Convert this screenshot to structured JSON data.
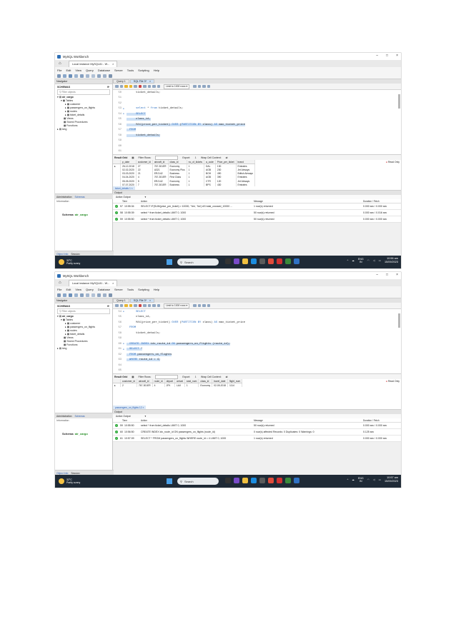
{
  "window": {
    "title": "MySQL Workbench",
    "connection_tab": "Local instance MySQL81 - W...",
    "controls": {
      "minimize": "–",
      "maximize": "□",
      "close": "×"
    }
  },
  "menu": [
    "File",
    "Edit",
    "View",
    "Query",
    "Database",
    "Server",
    "Tools",
    "Scripting",
    "Help"
  ],
  "navigator": {
    "header": "Navigator",
    "schemas_label": "SCHEMAS",
    "filter_placeholder": "Filter objects",
    "tree": {
      "schema": "air_cargo",
      "tables": "Tables",
      "table_items": [
        "customer",
        "passengers_on_flights",
        "routes",
        "ticket_details"
      ],
      "views": "Views",
      "procedures": "Stored Procedures",
      "functions": "Functions",
      "other_schema": "king"
    },
    "tabs": {
      "administration": "Administration",
      "schemas": "Schemas"
    },
    "information": "Information",
    "schema_label": "Schema:",
    "schema_value": "air_cargo",
    "bottom_tabs": {
      "object_info": "Object Info",
      "session": "Session"
    }
  },
  "editor": {
    "query_tab": "Query 1",
    "file_tab": "SQL File 3*",
    "limit_label": "Limit to 1000 rows"
  },
  "result": {
    "result_grid": "Result Grid",
    "filter_rows": "Filter Rows:",
    "export": "Export:",
    "wrap": "Wrap Cell Content:",
    "read_only": "Read Only"
  },
  "output": {
    "header": "Output",
    "action_output": "Action Output",
    "columns": {
      "time": "Time",
      "action": "Action",
      "message": "Message",
      "duration": "Duration / Fetch"
    }
  },
  "taskbar": {
    "temp": "32°C",
    "weather": "Partly sunny",
    "search": "Search",
    "lang1": "ENG",
    "lang2": "IN"
  },
  "screens": [
    {
      "sql_lines": [
        {
          "n": "50",
          "text": "    ticket_details;",
          "hl": false,
          "mark": ""
        },
        {
          "n": "51",
          "text": "",
          "hl": false,
          "mark": ""
        },
        {
          "n": "52",
          "text": "",
          "hl": false,
          "mark": ""
        },
        {
          "n": "53",
          "text": "    select * from ticket_details;",
          "hl": false,
          "mark": "●"
        },
        {
          "n": "54",
          "text": "    SELECT",
          "hl": true,
          "mark": "●"
        },
        {
          "n": "55",
          "text": "    class_id,",
          "hl": true,
          "mark": ""
        },
        {
          "n": "56",
          "text": "    MAX(price_per_ticket) OVER (PARTITION BY class) AS max_ticket_price",
          "hl": true,
          "mark": ""
        },
        {
          "n": "57",
          "text": "FROM",
          "hl": true,
          "mark": ""
        },
        {
          "n": "58",
          "text": "    ticket_details;",
          "hl": true,
          "mark": ""
        },
        {
          "n": "59",
          "text": "",
          "hl": false,
          "mark": ""
        },
        {
          "n": "60",
          "text": "",
          "hl": false,
          "mark": ""
        },
        {
          "n": "61",
          "text": "",
          "hl": false,
          "mark": ""
        }
      ],
      "grid": {
        "columns": [
          "p_date",
          "customer_id",
          "aircraft_id",
          "class_id",
          "no_of_tickets",
          "a_code",
          "Price_per_ticket",
          "brand"
        ],
        "rows": [
          [
            "26-12-2018",
            "27",
            "767-301ER",
            "Economy",
            "1",
            "DAL",
            "130",
            "Emirates"
          ],
          [
            "02-02-2020",
            "22",
            "A321",
            "Economy Plus",
            "1",
            "AGB",
            "230",
            "Jet Airways"
          ],
          [
            "03-03-2020",
            "21",
            "ERJ142",
            "Business",
            "1",
            "BOH",
            "490",
            "British Airways"
          ],
          [
            "04-04-2020",
            "4",
            "767-301ER",
            "First Class",
            "1",
            "AGB",
            "390",
            "Emirates"
          ],
          [
            "05-05-2020",
            "5",
            "ERJ142",
            "Economy",
            "1",
            "CTR",
            "120",
            "Jet Airways"
          ],
          [
            "07-07-2020",
            "7",
            "767-301ER",
            "Business",
            "1",
            "BPS",
            "430",
            "Emirates"
          ]
        ],
        "bottom_tab": "ticket_details 1 ×"
      },
      "output_rows": [
        {
          "num": "57",
          "time": "10:55:34",
          "action": "SELECT    IF(SUM(price_per_ticket) > 10000, 'Yes', 'No') AS total_crossed_10000 ...",
          "message": "1 row(s) returned",
          "duration": "0.000 sec / 0.000 sec"
        },
        {
          "num": "58",
          "time": "10:55:39",
          "action": "select * from ticket_details LIMIT 0, 1000",
          "message": "50 row(s) returned",
          "duration": "0.000 sec / 0.016 sec"
        },
        {
          "num": "59",
          "time": "10:55:50",
          "action": "select * from ticket_details LIMIT 0, 1000",
          "message": "50 row(s) returned",
          "duration": "0.000 sec / 0.000 sec"
        }
      ],
      "clock": {
        "time": "10:56 am",
        "date": "15/09/2023"
      }
    },
    {
      "sql_lines": [
        {
          "n": "54",
          "text": "    SELECT",
          "hl": false,
          "mark": "●"
        },
        {
          "n": "55",
          "text": "    class_id,",
          "hl": false,
          "mark": ""
        },
        {
          "n": "56",
          "text": "    MAX(price_per_ticket) OVER (PARTITION BY class) AS max_ticket_price",
          "hl": false,
          "mark": ""
        },
        {
          "n": "57",
          "text": "FROM",
          "hl": false,
          "mark": ""
        },
        {
          "n": "58",
          "text": "    ticket_details;",
          "hl": false,
          "mark": ""
        },
        {
          "n": "59",
          "text": "",
          "hl": false,
          "mark": ""
        },
        {
          "n": "60",
          "text": "CREATE INDEX idx_route_id ON passengers_on_flights (route_id);",
          "hl": true,
          "mark": "●"
        },
        {
          "n": "61",
          "text": "SELECT *",
          "hl": true,
          "mark": "●"
        },
        {
          "n": "62",
          "text": "FROM passengers_on_flights",
          "hl": true,
          "mark": ""
        },
        {
          "n": "63",
          "text": "WHERE route_id = 4;",
          "hl": true,
          "mark": ""
        },
        {
          "n": "64",
          "text": "",
          "hl": false,
          "mark": ""
        },
        {
          "n": "65",
          "text": "",
          "hl": false,
          "mark": ""
        }
      ],
      "grid": {
        "columns": [
          "customer_id",
          "aircraft_id",
          "route_id",
          "depart",
          "arrival",
          "seat_num",
          "class_id",
          "travel_date",
          "flight_num"
        ],
        "rows": [
          [
            "2",
            "767-301ER",
            "4",
            "JFK",
            "LAX",
            "1",
            "Economy",
            "02-05-2018",
            "1114"
          ]
        ],
        "bottom_tab": "passengers_on_flights 12 ×"
      },
      "output_rows": [
        {
          "num": "59",
          "time": "10:55:50",
          "action": "select * from ticket_details LIMIT 0, 1000",
          "message": "50 row(s) returned",
          "duration": "0.000 sec / 0.000 sec"
        },
        {
          "num": "60",
          "time": "10:56:50",
          "action": "CREATE INDEX idx_route_id ON passengers_on_flights (route_id)",
          "message": "0 row(s) affected Records: 0  Duplicates: 0  Warnings: 0",
          "duration": "0.125 sec"
        },
        {
          "num": "61",
          "time": "10:57:09",
          "action": "SELECT * FROM passengers_on_flights WHERE route_id = 4 LIMIT 0, 1000",
          "message": "1 row(s) returned",
          "duration": "0.000 sec / 0.000 sec"
        }
      ],
      "clock": {
        "time": "10:57 am",
        "date": "15/09/2023"
      }
    }
  ]
}
